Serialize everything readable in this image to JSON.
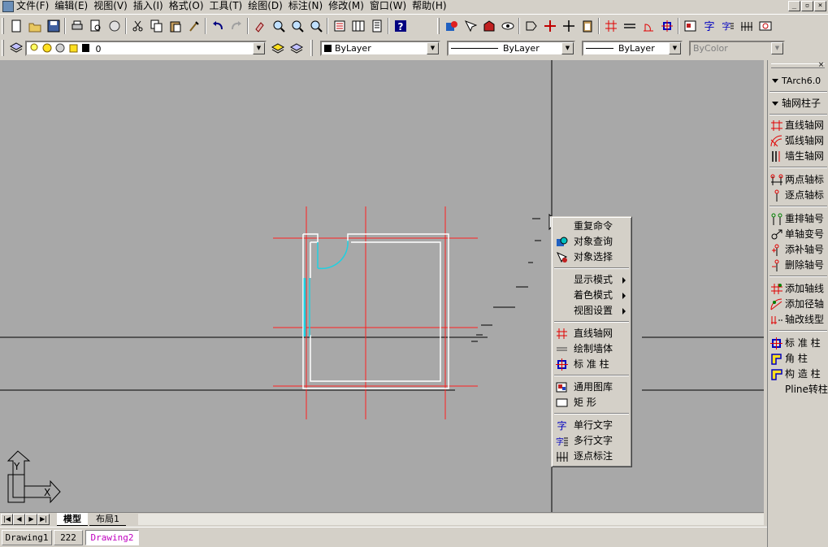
{
  "menubar": {
    "items": [
      "文件(F)",
      "编辑(E)",
      "视图(V)",
      "插入(I)",
      "格式(O)",
      "工具(T)",
      "绘图(D)",
      "标注(N)",
      "修改(M)",
      "窗口(W)",
      "帮助(H)"
    ],
    "window_controls": [
      "_",
      "▫",
      "×"
    ]
  },
  "toolbar2": {
    "layer_value": "0",
    "color_value": "ByLayer",
    "linetype_value": "ByLayer",
    "lineweight_value": "ByLayer",
    "plotstyle_value": "ByColor"
  },
  "context_menu": {
    "items": [
      {
        "label": "重复命令",
        "icon": "none"
      },
      {
        "label": "对象查询",
        "icon": "query-icon"
      },
      {
        "label": "对象选择",
        "icon": "select-icon"
      },
      {
        "label": "显示模式",
        "icon": "none",
        "submenu": true
      },
      {
        "label": "着色模式",
        "icon": "none",
        "submenu": true
      },
      {
        "label": "视图设置",
        "icon": "none",
        "submenu": true
      },
      {
        "label": "直线轴网",
        "icon": "grid-icon"
      },
      {
        "label": "绘制墙体",
        "icon": "wall-icon"
      },
      {
        "label": "标 准 柱",
        "icon": "column-icon"
      },
      {
        "label": "通用图库",
        "icon": "library-icon"
      },
      {
        "label": "矩    形",
        "icon": "rectangle-icon"
      },
      {
        "label": "单行文字",
        "icon": "text-icon"
      },
      {
        "label": "多行文字",
        "icon": "mtext-icon"
      },
      {
        "label": "逐点标注",
        "icon": "dimension-icon"
      }
    ]
  },
  "side_panel": {
    "title": "TArch6.0",
    "section": "轴网柱子",
    "close": "×",
    "items": [
      "直线轴网",
      "弧线轴网",
      "墙生轴网",
      "两点轴标",
      "逐点轴标",
      "重排轴号",
      "单轴变号",
      "添补轴号",
      "删除轴号",
      "添加轴线",
      "添加径轴",
      "轴改线型",
      "标 准 柱",
      "角    柱",
      "构 造 柱",
      "Pline转柱"
    ]
  },
  "ucs": {
    "y_label": "Y",
    "x_label": "X"
  },
  "layout_tabs": [
    "模型",
    "布局1"
  ],
  "document_tabs": [
    "Drawing1",
    "222",
    "Drawing2"
  ],
  "active_document": "Drawing2"
}
